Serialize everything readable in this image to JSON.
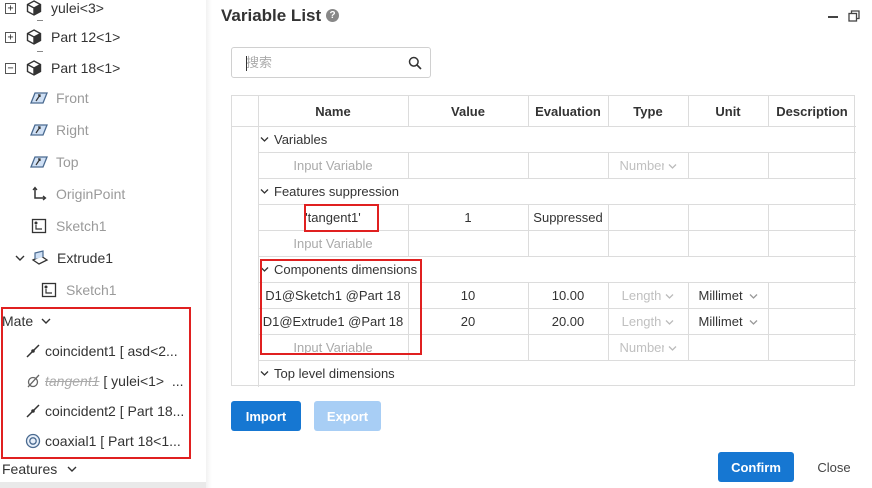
{
  "tree": {
    "items": [
      {
        "label": "yulei<3>"
      },
      {
        "label": "Part 12<1>"
      },
      {
        "label": "Part 18<1>"
      },
      {
        "label": "Front"
      },
      {
        "label": "Right"
      },
      {
        "label": "Top"
      },
      {
        "label": "OriginPoint"
      },
      {
        "label": "Sketch1"
      },
      {
        "label": "Extrude1"
      },
      {
        "label": "Sketch1"
      }
    ],
    "mate_label": "Mate",
    "mates": [
      {
        "name": "coincident1",
        "rest": " [ asd<2..."
      },
      {
        "name": "tangent1",
        "rest": " [ yulei<1>  ..."
      },
      {
        "name": "coincident2",
        "rest": " [ Part 18..."
      },
      {
        "name": "coaxial1",
        "rest": " [ Part 18<1..."
      }
    ],
    "features_label": "Features"
  },
  "dialog": {
    "title": "Variable List",
    "search_placeholder": "搜索",
    "columns": [
      "Name",
      "Value",
      "Evaluation",
      "Type",
      "Unit",
      "Description"
    ],
    "groups": {
      "variables": "Variables",
      "features": "Features suppression",
      "components": "Components dimensions",
      "top": "Top level dimensions"
    },
    "input_variable": "Input Variable",
    "type_placeholder": "Number",
    "suppress_row": {
      "name": "'tangent1'",
      "value": "1",
      "evaluation": "Suppressed"
    },
    "dim_rows": [
      {
        "name": "D1@Sketch1 @Part 18",
        "value": "10",
        "evaluation": "10.00",
        "type": "Length",
        "unit": "Millimet"
      },
      {
        "name": "D1@Extrude1 @Part 18",
        "value": "20",
        "evaluation": "20.00",
        "type": "Length",
        "unit": "Millimet"
      }
    ],
    "buttons": {
      "import": "Import",
      "export": "Export",
      "confirm": "Confirm",
      "close": "Close"
    }
  }
}
